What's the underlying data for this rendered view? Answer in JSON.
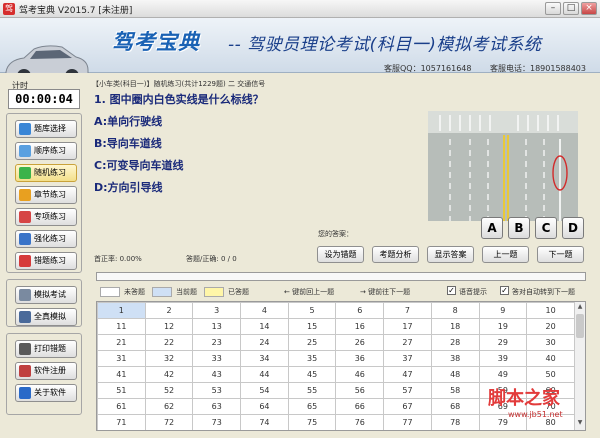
{
  "window": {
    "title": "驾考宝典 V2015.7 [未注册]",
    "controls": {
      "minimize": "–",
      "maximize": "□",
      "close": "×"
    }
  },
  "banner": {
    "brand": "驾考宝典",
    "subtitle": "-- 驾驶员理论考试(科目一)模拟考试系统",
    "qq": "客服QQ：1057161648",
    "phone": "客服电话：18901588403"
  },
  "sidebar": {
    "timer_label": "计时",
    "timer": "00:00:04",
    "groups": [
      [
        {
          "label": "题库选择",
          "icon": "database-icon",
          "color": "#3a86d6"
        },
        {
          "label": "顺序练习",
          "icon": "list-icon",
          "color": "#5aa0e0"
        },
        {
          "label": "随机练习",
          "icon": "shuffle-icon",
          "color": "#3bb34a",
          "active": true
        },
        {
          "label": "章节练习",
          "icon": "folder-icon",
          "color": "#e8a020"
        },
        {
          "label": "专项练习",
          "icon": "target-icon",
          "color": "#d64545"
        },
        {
          "label": "强化练习",
          "icon": "chart-icon",
          "color": "#3a74c8"
        },
        {
          "label": "错题练习",
          "icon": "flag-icon",
          "color": "#d63a3a"
        }
      ],
      [
        {
          "label": "模拟考试",
          "icon": "document-icon",
          "color": "#7a8aa0"
        },
        {
          "label": "全真模拟",
          "icon": "monitor-icon",
          "color": "#4a6a9a"
        }
      ],
      [
        {
          "label": "打印错题",
          "icon": "printer-icon",
          "color": "#5a5a5a"
        },
        {
          "label": "软件注册",
          "icon": "key-icon",
          "color": "#c04040"
        },
        {
          "label": "关于软件",
          "icon": "info-icon",
          "color": "#2a6ac8"
        }
      ]
    ]
  },
  "content": {
    "breadcrumb": "【小车类(科目一)】随机练习(共计1229题) 二 交通信号",
    "question": "1. 图中圈内白色实线是什么标线？",
    "options": [
      "A:单向行驶线",
      "B:导向车道线",
      "C:可变导向车道线",
      "D:方向引导线"
    ],
    "answer_label": "您的答案：",
    "answer_keys": [
      "A",
      "B",
      "C",
      "D"
    ],
    "correct_rate": "首正率: 0.00%",
    "answered": "答题/正确: 0 / 0",
    "actions": [
      "设为错题",
      "考题分析",
      "显示答案",
      "上一题",
      "下一题"
    ],
    "progress": 0.0
  },
  "legend": {
    "unanswered": "未答题",
    "current": "当前题",
    "answered": "已答题",
    "prev_hint": "← 键前回上一题",
    "next_hint": "→ 键前往下一题",
    "voice_prompt": "语音提示",
    "auto_next": "答对自动转到下一题",
    "colors": {
      "unanswered": "#ffffff",
      "current": "#cfe0f5",
      "answered": "#fff6a8"
    }
  },
  "question_grid": [
    [
      "1",
      "2",
      "3",
      "4",
      "5",
      "6",
      "7",
      "8",
      "9",
      "10"
    ],
    [
      "11",
      "12",
      "13",
      "14",
      "15",
      "16",
      "17",
      "18",
      "19",
      "20"
    ],
    [
      "21",
      "22",
      "23",
      "24",
      "25",
      "26",
      "27",
      "28",
      "29",
      "30"
    ],
    [
      "31",
      "32",
      "33",
      "34",
      "35",
      "36",
      "37",
      "38",
      "39",
      "40"
    ],
    [
      "41",
      "42",
      "43",
      "44",
      "45",
      "46",
      "47",
      "48",
      "49",
      "50"
    ],
    [
      "51",
      "52",
      "53",
      "54",
      "55",
      "56",
      "57",
      "58",
      "59",
      "60"
    ],
    [
      "61",
      "62",
      "63",
      "64",
      "65",
      "66",
      "67",
      "68",
      "69",
      "70"
    ],
    [
      "71",
      "72",
      "73",
      "74",
      "75",
      "76",
      "77",
      "78",
      "79",
      "80"
    ]
  ],
  "watermark": {
    "main": "脚本之家",
    "sub": "www.jb51.net"
  }
}
